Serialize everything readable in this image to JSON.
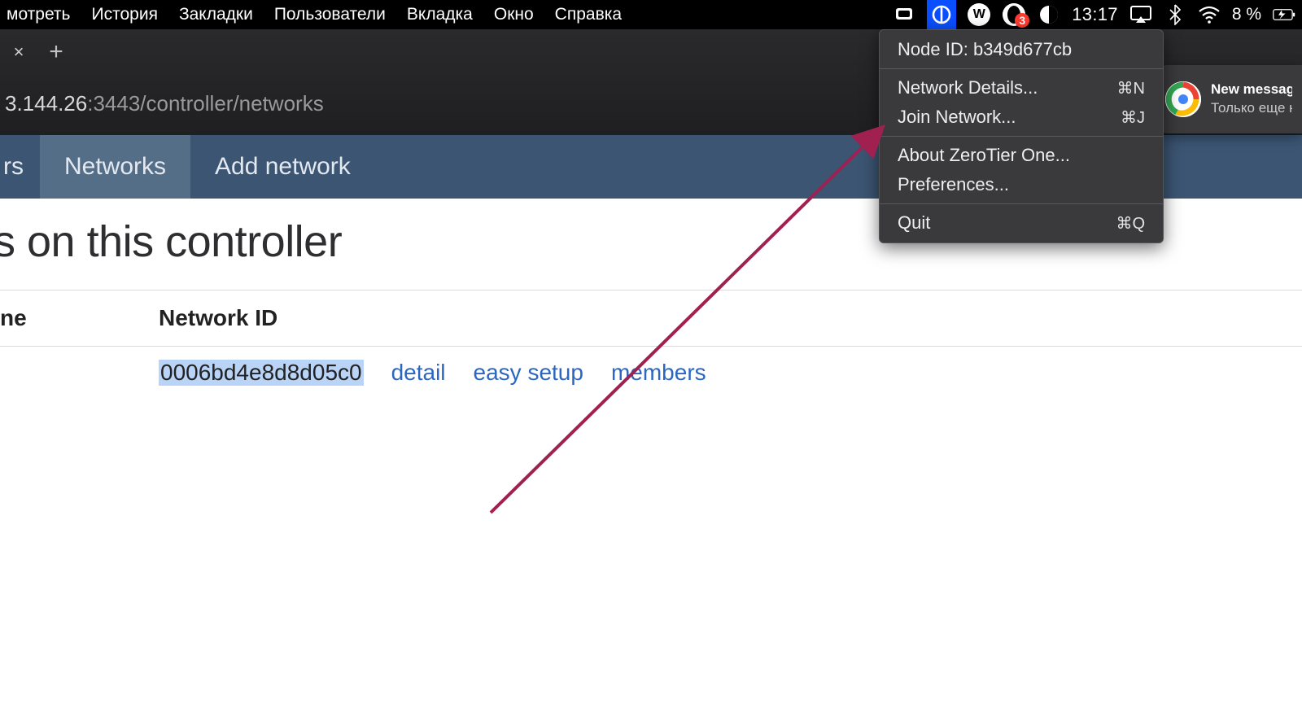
{
  "menubar": {
    "items": [
      "мотреть",
      "История",
      "Закладки",
      "Пользователи",
      "Вкладка",
      "Окно",
      "Справка"
    ],
    "badge_count": "3",
    "clock": "13:17",
    "battery": "8 %"
  },
  "browser": {
    "tab_close": "×",
    "tab_new": "+",
    "addr": {
      "host": "3.144.26",
      "rest": ":3443/controller/networks"
    }
  },
  "zt_menu": {
    "node_id_label": "Node ID:",
    "node_id_value": "b349d677cb",
    "items": [
      {
        "label": "Network Details...",
        "shortcut": "⌘N"
      },
      {
        "label": "Join Network...",
        "shortcut": "⌘J"
      }
    ],
    "items2": [
      {
        "label": "About ZeroTier One..."
      },
      {
        "label": "Preferences..."
      }
    ],
    "quit": {
      "label": "Quit",
      "shortcut": "⌘Q"
    }
  },
  "notification": {
    "title": "New message",
    "body": "Только еще нуж"
  },
  "site_nav": {
    "tab0": "rs",
    "tab1": "Networks",
    "tab2": "Add network"
  },
  "page": {
    "title": "s on this controller",
    "col_name": "ne",
    "col_netid": "Network ID",
    "row0": {
      "network_id": "0006bd4e8d8d05c0",
      "detail": "detail",
      "easy": "easy setup",
      "members": "members"
    }
  }
}
